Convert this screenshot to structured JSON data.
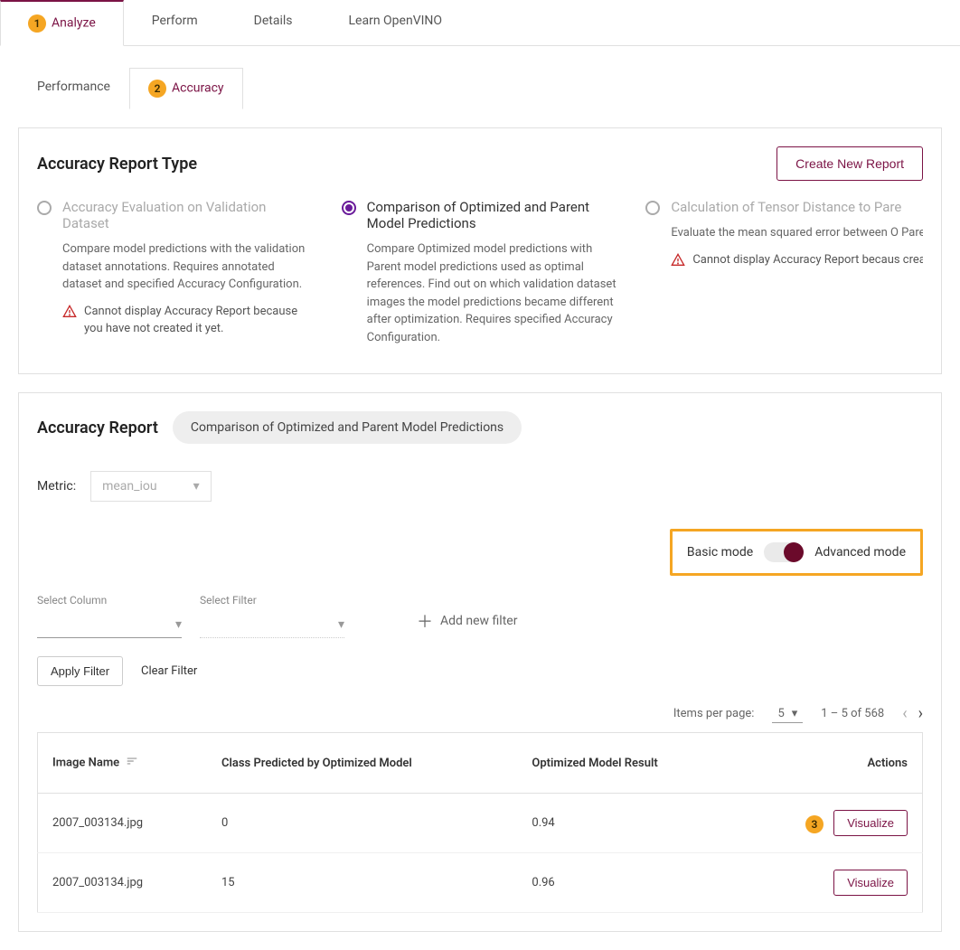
{
  "topTabs": {
    "analyze": "Analyze",
    "perform": "Perform",
    "details": "Details",
    "learn": "Learn OpenVINO"
  },
  "subTabs": {
    "performance": "Performance",
    "accuracy": "Accuracy"
  },
  "badges": {
    "one": "1",
    "two": "2",
    "three": "3"
  },
  "reportType": {
    "title": "Accuracy Report Type",
    "createButton": "Create New Report",
    "opt1": {
      "title": "Accuracy Evaluation on Validation Dataset",
      "desc": "Compare model predictions with the validation dataset annotations. Requires annotated dataset and specified Accuracy Configuration.",
      "warning": "Cannot display Accuracy Report because you have not created it yet."
    },
    "opt2": {
      "title": "Comparison of Optimized and Parent Model Predictions",
      "desc": "Compare Optimized model predictions with Parent model predictions used as optimal references. Find out on which validation dataset images the model predictions became different after optimization. Requires specified Accuracy Configuration."
    },
    "opt3": {
      "title": "Calculation of Tensor Distance to Pare",
      "desc": "Evaluate the mean squared error between O Parent models output on tensor level for eac validation dataset.",
      "warning": "Cannot display Accuracy Report becaus created it yet."
    }
  },
  "report": {
    "title": "Accuracy Report",
    "pill": "Comparison of Optimized and Parent Model Predictions",
    "metricLabel": "Metric:",
    "metricValue": "mean_iou",
    "basicMode": "Basic mode",
    "advancedMode": "Advanced mode",
    "filterColLabel": "Select Column",
    "filterFilterLabel": "Select Filter",
    "addFilter": "Add new filter",
    "applyFilter": "Apply Filter",
    "clearFilter": "Clear Filter"
  },
  "paginator": {
    "itemsPerPageLabel": "Items per page:",
    "itemsPerPage": "5",
    "range": "1 – 5 of 568"
  },
  "table": {
    "headers": {
      "imageName": "Image Name",
      "classPredicted": "Class Predicted by Optimized Model",
      "result": "Optimized Model Result",
      "actions": "Actions"
    },
    "rows": [
      {
        "name": "2007_003134.jpg",
        "cls": "0",
        "res": "0.94",
        "action": "Visualize"
      },
      {
        "name": "2007_003134.jpg",
        "cls": "15",
        "res": "0.96",
        "action": "Visualize"
      }
    ]
  }
}
